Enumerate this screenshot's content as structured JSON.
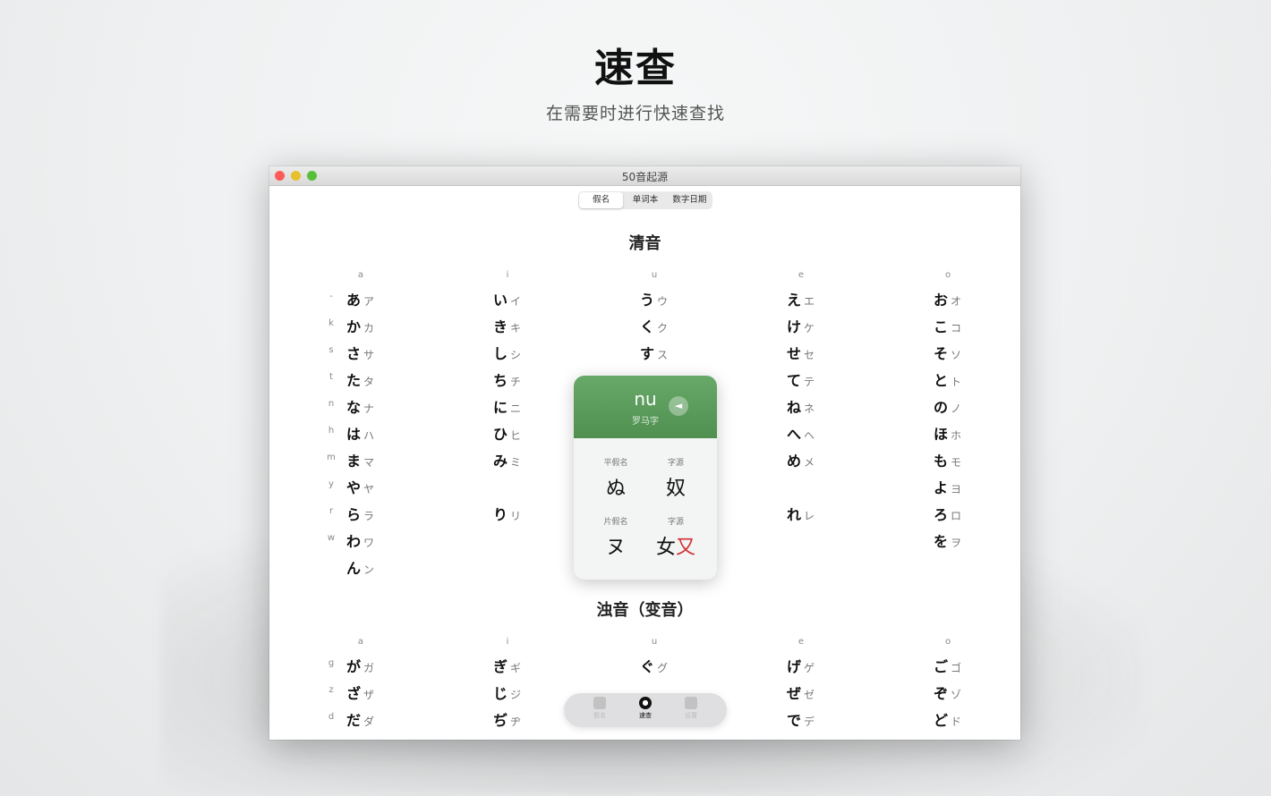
{
  "hero": {
    "title": "速查",
    "subtitle": "在需要时进行快速查找"
  },
  "window": {
    "title": "50音起源",
    "segments": [
      "假名",
      "单词本",
      "数字日期"
    ]
  },
  "sections": [
    {
      "title": "清音",
      "columns": [
        "a",
        "i",
        "u",
        "e",
        "o"
      ],
      "rows": [
        {
          "label": "-",
          "cells": [
            [
              "あ",
              "ア"
            ],
            [
              "い",
              "イ"
            ],
            [
              "う",
              "ウ"
            ],
            [
              "え",
              "エ"
            ],
            [
              "お",
              "オ"
            ]
          ]
        },
        {
          "label": "k",
          "cells": [
            [
              "か",
              "カ"
            ],
            [
              "き",
              "キ"
            ],
            [
              "く",
              "ク"
            ],
            [
              "け",
              "ケ"
            ],
            [
              "こ",
              "コ"
            ]
          ]
        },
        {
          "label": "s",
          "cells": [
            [
              "さ",
              "サ"
            ],
            [
              "し",
              "シ"
            ],
            [
              "す",
              "ス"
            ],
            [
              "せ",
              "セ"
            ],
            [
              "そ",
              "ソ"
            ]
          ]
        },
        {
          "label": "t",
          "cells": [
            [
              "た",
              "タ"
            ],
            [
              "ち",
              "チ"
            ],
            null,
            [
              "て",
              "テ"
            ],
            [
              "と",
              "ト"
            ]
          ]
        },
        {
          "label": "n",
          "cells": [
            [
              "な",
              "ナ"
            ],
            [
              "に",
              "ニ"
            ],
            null,
            [
              "ね",
              "ネ"
            ],
            [
              "の",
              "ノ"
            ]
          ]
        },
        {
          "label": "h",
          "cells": [
            [
              "は",
              "ハ"
            ],
            [
              "ひ",
              "ヒ"
            ],
            null,
            [
              "へ",
              "ヘ"
            ],
            [
              "ほ",
              "ホ"
            ]
          ]
        },
        {
          "label": "m",
          "cells": [
            [
              "ま",
              "マ"
            ],
            [
              "み",
              "ミ"
            ],
            null,
            [
              "め",
              "メ"
            ],
            [
              "も",
              "モ"
            ]
          ]
        },
        {
          "label": "y",
          "cells": [
            [
              "や",
              "ヤ"
            ],
            null,
            null,
            null,
            [
              "よ",
              "ヨ"
            ]
          ]
        },
        {
          "label": "r",
          "cells": [
            [
              "ら",
              "ラ"
            ],
            [
              "り",
              "リ"
            ],
            null,
            [
              "れ",
              "レ"
            ],
            [
              "ろ",
              "ロ"
            ]
          ]
        },
        {
          "label": "w",
          "cells": [
            [
              "わ",
              "ワ"
            ],
            null,
            null,
            null,
            [
              "を",
              "ヲ"
            ]
          ]
        },
        {
          "label": "",
          "cells": [
            [
              "ん",
              "ン"
            ],
            null,
            null,
            null,
            null
          ]
        }
      ]
    },
    {
      "title": "浊音（变音）",
      "columns": [
        "a",
        "i",
        "u",
        "e",
        "o"
      ],
      "rows": [
        {
          "label": "g",
          "cells": [
            [
              "が",
              "ガ"
            ],
            [
              "ぎ",
              "ギ"
            ],
            [
              "ぐ",
              "グ"
            ],
            [
              "げ",
              "ゲ"
            ],
            [
              "ご",
              "ゴ"
            ]
          ]
        },
        {
          "label": "z",
          "cells": [
            [
              "ざ",
              "ザ"
            ],
            [
              "じ",
              "ジ"
            ],
            null,
            [
              "ぜ",
              "ゼ"
            ],
            [
              "ぞ",
              "ゾ"
            ]
          ]
        },
        {
          "label": "d",
          "cells": [
            [
              "だ",
              "ダ"
            ],
            [
              "ぢ",
              "ヂ"
            ],
            null,
            [
              "で",
              "デ"
            ],
            [
              "ど",
              "ド"
            ]
          ]
        }
      ]
    }
  ],
  "card": {
    "romaji": "nu",
    "romaji_label": "罗马字",
    "speaker_icon": "speaker-icon",
    "hiragana_label": "平假名",
    "hiragana": "ぬ",
    "hira_origin_label": "字源",
    "hira_origin": "奴",
    "katakana_label": "片假名",
    "katakana": "ヌ",
    "kata_origin_label": "字源",
    "kata_origin_left": "女",
    "kata_origin_right": "又",
    "accent_color": "#5a9b5b"
  },
  "tabbar": {
    "tabs": [
      {
        "label": "假名",
        "icon": "book-icon",
        "active": false
      },
      {
        "label": "速查",
        "icon": "lookup-icon",
        "active": true
      },
      {
        "label": "设置",
        "icon": "settings-icon",
        "active": false
      }
    ]
  }
}
